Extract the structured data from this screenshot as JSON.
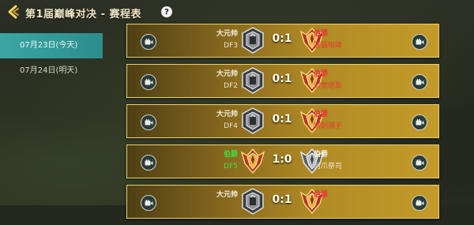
{
  "header": {
    "title": "第1届巅峰对决 - 赛程表",
    "help_label": "?"
  },
  "date_tabs": [
    {
      "label": "07月23日(今天)",
      "active": true
    },
    {
      "label": "07月24日(明天)",
      "active": false
    }
  ],
  "matches": [
    {
      "left": {
        "name": "大元帅",
        "sub": "DF3",
        "crest": "iron",
        "name_color": "#f4eede",
        "sub_color": "#e8e2cc"
      },
      "score": "0:1",
      "right": {
        "name": "伯爵",
        "sub": "雾霾咆哮",
        "crest": "gold",
        "name_color": "#e8343a",
        "sub_color": "#e23b31"
      }
    },
    {
      "left": {
        "name": "大元帅",
        "sub": "DF2",
        "crest": "iron",
        "name_color": "#f4eede",
        "sub_color": "#e8e2cc"
      },
      "score": "0:1",
      "right": {
        "name": "伯爵",
        "sub": "幻觉绝影",
        "crest": "gold",
        "name_color": "#e8343a",
        "sub_color": "#e23b31"
      }
    },
    {
      "left": {
        "name": "大元帅",
        "sub": "DF4",
        "crest": "iron",
        "name_color": "#f4eede",
        "sub_color": "#e8e2cc"
      },
      "score": "0:1",
      "right": {
        "name": "伯爵",
        "sub": "钢制骑手",
        "crest": "gold",
        "name_color": "#e8343a",
        "sub_color": "#e23b31"
      }
    },
    {
      "left": {
        "name": "伯爵",
        "sub": "DF5",
        "crest": "gold",
        "name_color": "#3fe03a",
        "sub_color": "#43e43c"
      },
      "score": "1:0",
      "right": {
        "name": "伯爵",
        "sub": "河爪祭司",
        "crest": "silver",
        "name_color": "#f4eede",
        "sub_color": "#e8e2cc"
      }
    },
    {
      "left": {
        "name": "大元帅",
        "sub": "",
        "crest": "iron",
        "name_color": "#f4eede",
        "sub_color": "#e8e2cc"
      },
      "score": "0:1",
      "right": {
        "name": "伯爵",
        "sub": "",
        "crest": "gold",
        "name_color": "#e8343a",
        "sub_color": "#e23b31"
      }
    }
  ],
  "colors": {
    "accent_teal": "#3aa6a4",
    "row_gold": "#c49b2a",
    "winner_green": "#3fe03a",
    "loser_red": "#e8343a"
  },
  "icons": {
    "back": "chevron-left-icon",
    "help": "help-icon",
    "replay": "replay-video-icon"
  }
}
